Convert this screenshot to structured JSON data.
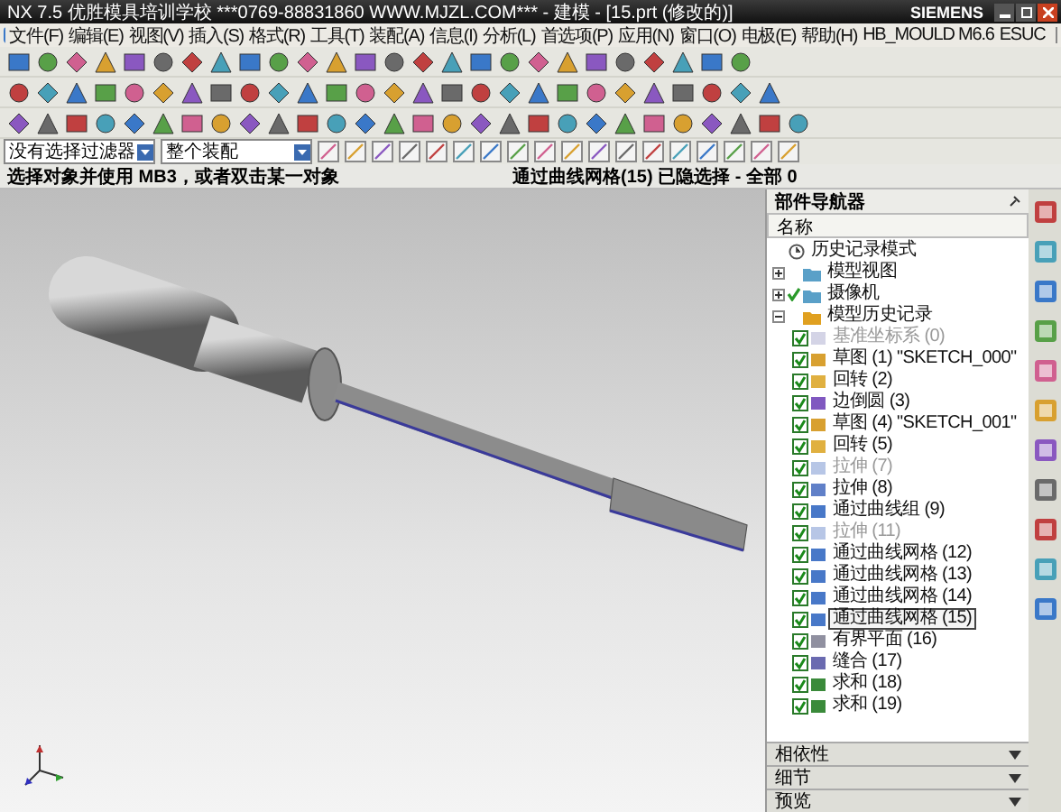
{
  "window": {
    "title": "NX 7.5 优胜模具培训学校 ***0769-88831860 WWW.MJZL.COM*** - 建模 - [15.prt (修改的)]",
    "brand": "SIEMENS"
  },
  "menu": [
    "文件(F)",
    "编辑(E)",
    "视图(V)",
    "插入(S)",
    "格式(R)",
    "工具(T)",
    "装配(A)",
    "信息(I)",
    "分析(L)",
    "首选项(P)",
    "应用(N)",
    "窗口(O)",
    "电极(E)",
    "帮助(H)",
    "HB_MOULD M6.6",
    "ESUC"
  ],
  "selection_bar": {
    "filter": "没有选择过滤器",
    "scope": "整个装配"
  },
  "status": {
    "prompt": "选择对象并使用 MB3，或者双击某一对象",
    "info": "通过曲线网格(15) 已隐选择 - 全部 0"
  },
  "part_navigator": {
    "title": "部件导航器",
    "column": "名称",
    "items": [
      {
        "label": "历史记录模式",
        "kind": "mode"
      },
      {
        "label": "模型视图",
        "kind": "folder",
        "expanded": false,
        "checked": false
      },
      {
        "label": "摄像机",
        "kind": "folder",
        "expanded": false,
        "checked": true
      },
      {
        "label": "模型历史记录",
        "kind": "folder",
        "expanded": true,
        "checked": false,
        "children": [
          {
            "label": "基准坐标系 (0)",
            "kind": "datum",
            "checked": true,
            "active": false,
            "selected": false
          },
          {
            "label": "草图 (1) \"SKETCH_000\"",
            "kind": "sketch",
            "checked": true,
            "active": true,
            "selected": false
          },
          {
            "label": "回转 (2)",
            "kind": "revolve",
            "checked": true,
            "active": true,
            "selected": false
          },
          {
            "label": "边倒圆 (3)",
            "kind": "blend",
            "checked": true,
            "active": true,
            "selected": false
          },
          {
            "label": "草图 (4) \"SKETCH_001\"",
            "kind": "sketch",
            "checked": true,
            "active": true,
            "selected": false
          },
          {
            "label": "回转 (5)",
            "kind": "revolve",
            "checked": true,
            "active": true,
            "selected": false
          },
          {
            "label": "拉伸 (7)",
            "kind": "extrude",
            "checked": true,
            "active": false,
            "selected": false
          },
          {
            "label": "拉伸 (8)",
            "kind": "extrude",
            "checked": true,
            "active": true,
            "selected": false
          },
          {
            "label": "通过曲线组 (9)",
            "kind": "mesh",
            "checked": true,
            "active": true,
            "selected": false
          },
          {
            "label": "拉伸 (11)",
            "kind": "extrude",
            "checked": true,
            "active": false,
            "selected": false
          },
          {
            "label": "通过曲线网格 (12)",
            "kind": "mesh",
            "checked": true,
            "active": true,
            "selected": false
          },
          {
            "label": "通过曲线网格 (13)",
            "kind": "mesh",
            "checked": true,
            "active": true,
            "selected": false
          },
          {
            "label": "通过曲线网格 (14)",
            "kind": "mesh",
            "checked": true,
            "active": true,
            "selected": false
          },
          {
            "label": "通过曲线网格 (15)",
            "kind": "mesh",
            "checked": true,
            "active": true,
            "selected": true
          },
          {
            "label": "有界平面 (16)",
            "kind": "plane",
            "checked": true,
            "active": true,
            "selected": false
          },
          {
            "label": "缝合 (17)",
            "kind": "sew",
            "checked": true,
            "active": true,
            "selected": false
          },
          {
            "label": "求和 (18)",
            "kind": "unite",
            "checked": true,
            "active": true,
            "selected": false
          },
          {
            "label": "求和 (19)",
            "kind": "unite",
            "checked": true,
            "active": true,
            "selected": false
          }
        ]
      }
    ]
  },
  "bottom_panels": [
    "相依性",
    "细节",
    "预览"
  ]
}
